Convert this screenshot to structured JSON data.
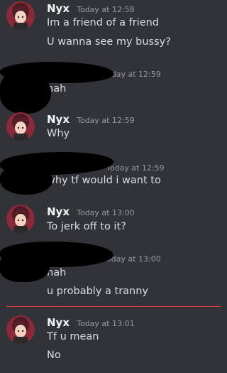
{
  "colors": {
    "background": "#313338",
    "username": "#f2f3f5",
    "timestamp": "#949ba4",
    "message": "#dbdee1",
    "new_message_divider": "#f23f43",
    "redaction": "#000000"
  },
  "messages": [
    {
      "author": "Nyx",
      "timestamp": "Today at 12:58",
      "lines": [
        "Im a friend of a friend",
        "U wanna see my bussy?"
      ]
    },
    {
      "author": "",
      "timestamp": "oday at 12:59",
      "lines": [
        "nah"
      ]
    },
    {
      "author": "Nyx",
      "timestamp": "Today at 12:59",
      "lines": [
        "Why"
      ]
    },
    {
      "author": "",
      "timestamp": "Today at 12:59",
      "lines": [
        "why tf would i want to"
      ]
    },
    {
      "author": "Nyx",
      "timestamp": "Today at 13:00",
      "lines": [
        "To jerk off to it?"
      ]
    },
    {
      "author": "",
      "timestamp": "oday at 13:00",
      "lines": [
        "nah",
        "u probably a tranny"
      ]
    },
    {
      "author": "Nyx",
      "timestamp": "Today at 13:01",
      "lines": [
        "Tf u mean",
        "No"
      ]
    }
  ]
}
